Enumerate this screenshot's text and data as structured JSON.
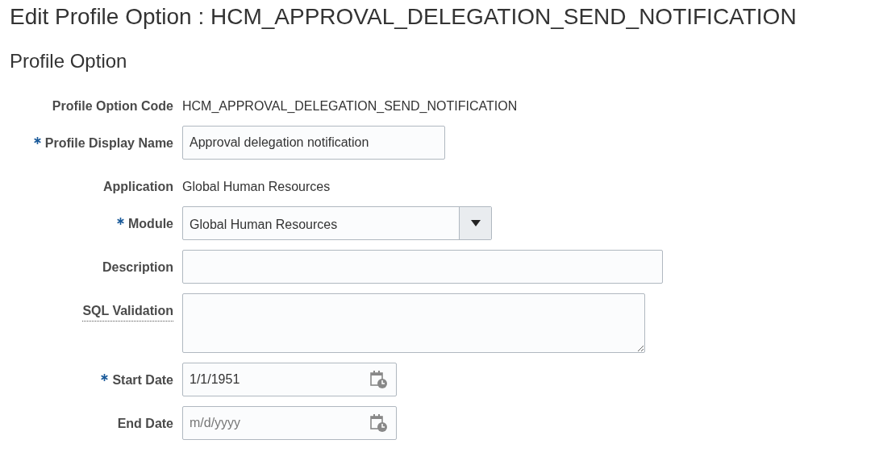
{
  "page_title": "Edit Profile Option : HCM_APPROVAL_DELEGATION_SEND_NOTIFICATION",
  "section_title": "Profile Option",
  "fields": [
    {
      "kind": "text",
      "label": "Profile Option Code",
      "required": false,
      "value": "HCM_APPROVAL_DELEGATION_SEND_NOTIFICATION"
    },
    {
      "kind": "input",
      "label": "Profile Display Name",
      "required": true,
      "value": "Approval delegation notification"
    },
    {
      "kind": "text",
      "label": "Application",
      "required": false,
      "value": "Global Human Resources"
    },
    {
      "kind": "select",
      "label": "Module",
      "required": true,
      "value": "Global Human Resources"
    },
    {
      "kind": "input",
      "label": "Description",
      "required": false
    },
    {
      "kind": "textarea",
      "label": "SQL Validation",
      "required": false,
      "has_help": true
    },
    {
      "kind": "date",
      "label": "Start Date",
      "required": true,
      "value": "1/1/1951"
    },
    {
      "kind": "date",
      "label": "End Date",
      "required": false,
      "placeholder": "m/d/yyyy"
    }
  ]
}
